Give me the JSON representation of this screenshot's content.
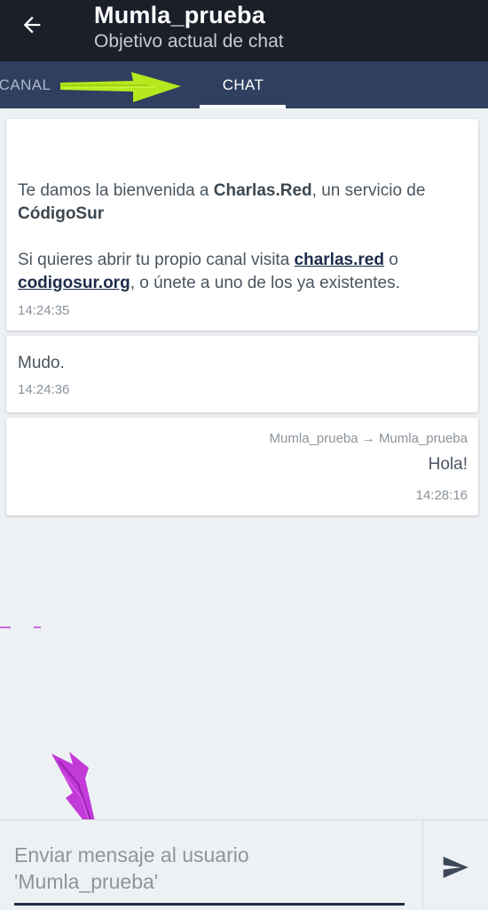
{
  "header": {
    "title": "Mumla_prueba",
    "subtitle": "Objetivo actual de chat",
    "back_icon": "arrow-left-icon"
  },
  "tabs": [
    {
      "label": "CANAL",
      "active": false
    },
    {
      "label": "CHAT",
      "active": true
    }
  ],
  "messages": [
    {
      "p1_pre": "Te damos la bienvenida a ",
      "p1_bold1": "Charlas.Red",
      "p1_mid": ", un servicio de ",
      "p1_bold2": "CódigoSur",
      "p2_pre": "Si quieres abrir tu propio canal visita ",
      "p2_link1": "charlas.red",
      "p2_mid": " o ",
      "p2_link2": "codigosur.org",
      "p2_post": ", o únete a uno de los ya existentes.",
      "time": "14:24:35"
    },
    {
      "text": "Mudo.",
      "time": "14:24:36"
    },
    {
      "route": "Mumla_prueba → Mumla_prueba",
      "text": "Hola!",
      "time": "14:28:16"
    }
  ],
  "composer": {
    "placeholder": "Enviar mensaje al usuario\n'Mumla_prueba'",
    "send_icon": "send-icon"
  },
  "colors": {
    "appbar": "#1b1f2a",
    "tabbar": "#2f3f5f",
    "background": "#eef1f4",
    "annotation_green": "#b6e81e",
    "annotation_purple": "#c23ad8"
  }
}
